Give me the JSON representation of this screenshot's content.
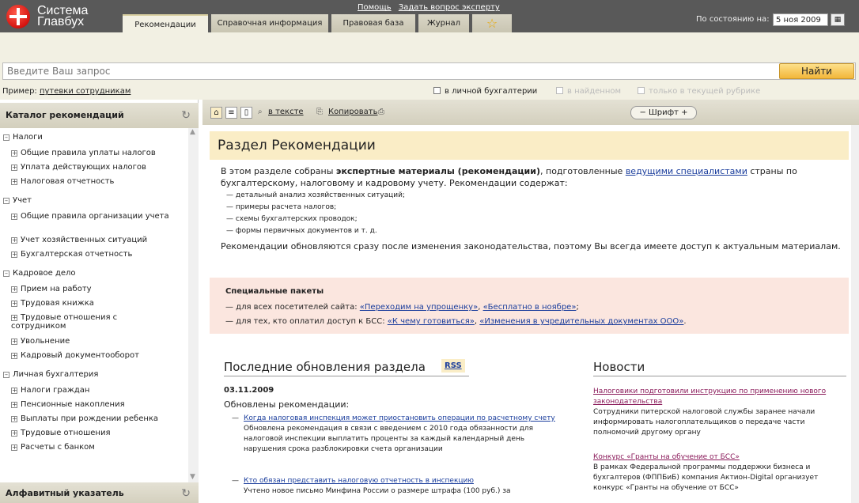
{
  "brand": {
    "line1": "Система",
    "line2": "Главбух"
  },
  "top_links": [
    "Помощь",
    "Задать вопрос эксперту"
  ],
  "tabs": [
    {
      "label": "Рекомендации",
      "active": true
    },
    {
      "label": "Справочная информация",
      "active": false
    },
    {
      "label": "Правовая база",
      "active": false
    },
    {
      "label": "Журнал",
      "active": false
    }
  ],
  "date": {
    "label": "По состоянию на:",
    "value": "5 ноя 2009"
  },
  "search": {
    "placeholder": "Введите Ваш запрос",
    "button": "Найти"
  },
  "example": {
    "label": "Пример:",
    "link": "путевки сотрудникам"
  },
  "filters": [
    {
      "label": "в личной бухгалтерии",
      "enabled": true
    },
    {
      "label": "в найденном",
      "enabled": false
    },
    {
      "label": "только в текущей рубрике",
      "enabled": false
    }
  ],
  "catalog": {
    "title": "Каталог рекомендаций",
    "groups": [
      {
        "label": "Налоги",
        "items": [
          "Общие правила уплаты налогов",
          "Уплата действующих налогов",
          "Налоговая отчетность"
        ]
      },
      {
        "label": "Учет",
        "items": [
          "Общие правила организации учета",
          "Учет хозяйственных ситуаций",
          "Бухгалтерская отчетность"
        ]
      },
      {
        "label": "Кадровое дело",
        "items": [
          "Прием на работу",
          "Трудовая книжка",
          "Трудовые отношения с сотрудником",
          "Увольнение",
          "Кадровый документооборот"
        ]
      },
      {
        "label": "Личная бухгалтерия",
        "items": [
          "Налоги граждан",
          "Пенсионные накопления",
          "Выплаты при рождении ребенка",
          "Трудовые отношения",
          "Расчеты с банком"
        ]
      }
    ]
  },
  "alpha_index": {
    "title": "Алфавитный указатель"
  },
  "toolbar": {
    "in_text": "в тексте",
    "copy": "Копировать",
    "font": "Шрифт"
  },
  "section": {
    "title": "Раздел Рекомендации",
    "intro_1": "В этом разделе собраны ",
    "intro_bold": "экспертные материалы (рекомендации)",
    "intro_2": ", подготовленные ",
    "intro_link": "ведущими специалистами",
    "intro_3": " страны по бухгалтерскому, налоговому и кадровому учету. Рекомендации содержат:",
    "bullets": [
      "— детальный анализ хозяйственных ситуаций;",
      "— примеры расчета налогов;",
      "— схемы бухгалтерских проводок;",
      "— формы первичных документов и т. д."
    ],
    "para2": "Рекомендации обновляются сразу после изменения законодательства, поэтому Вы всегда имеете доступ к актуальным материалам."
  },
  "special": {
    "title": "Специальные пакеты",
    "line1_prefix": "— для всех посетителей сайта: ",
    "line1_links": [
      "«Переходим на упрощенку»",
      "«Бесплатно в ноябре»"
    ],
    "line2_prefix": "— для тех, кто оплатил доступ к БСС: ",
    "line2_links": [
      "«К чему готовиться»",
      "«Изменения в учредительных документах ООО»"
    ]
  },
  "updates": {
    "title": "Последние обновления раздела",
    "rss": "RSS",
    "date": "03.11.2009",
    "label": "Обновлены рекомендации:",
    "items": [
      {
        "link": "Когда налоговая инспекция может приостановить операции по расчетному счету",
        "text": "Обновлена рекомендация в связи с введением с 2010 года обязанности для налоговой инспекции выплатить проценты за каждый календарный день нарушения срока разблокировки счета организации"
      },
      {
        "link": "Кто обязан представить налоговую отчетность в инспекцию",
        "text": "Учтено новое письмо Минфина России о размере штрафа (100 руб.) за"
      }
    ]
  },
  "news": {
    "title": "Новости",
    "items": [
      {
        "link": "Налоговики подготовили инструкцию по применению нового законодательства",
        "text": "Сотрудники питерской налоговой службы заранее начали информировать налогоплательщиков о передаче части полномочий другому органу"
      },
      {
        "link": "Конкурс «Гранты на обучение от БСС»",
        "text": "В рамках Федеральной программы поддержки бизнеса и бухгалтеров (ФППБиБ) компания Актион-Digital организует конкурс «Гранты на обучение от БСС»"
      }
    ]
  }
}
